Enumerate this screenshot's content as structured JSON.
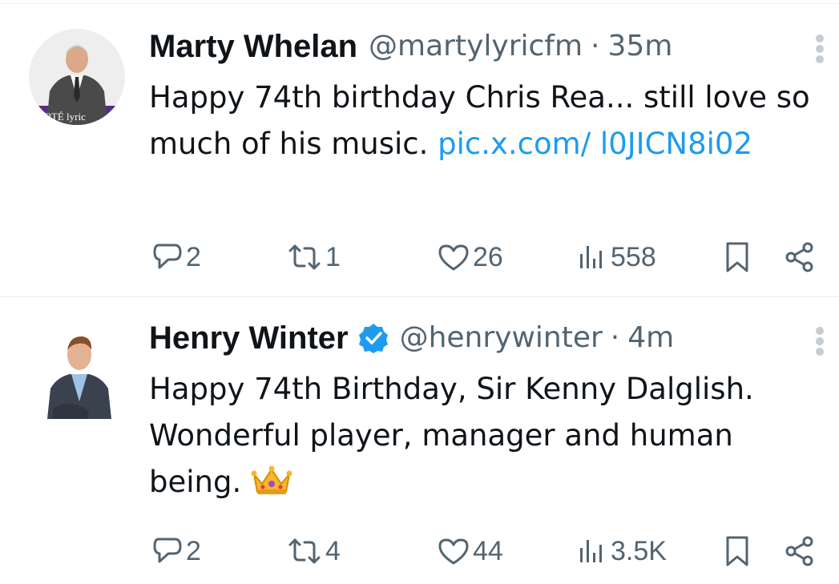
{
  "tweets": [
    {
      "name": "Marty Whelan",
      "handle": "@martylyricfm",
      "separator": "·",
      "time": "35m",
      "verified": false,
      "avatar_text": "RTÉ lyric",
      "text": "Happy 74th birthday Chris Rea... still love so much of his music. ",
      "link_text": "pic.x.com/ l0JICN8i02",
      "emoji": "",
      "stats": {
        "replies": "2",
        "reposts": "1",
        "likes": "26",
        "views": "558"
      }
    },
    {
      "name": "Henry Winter",
      "handle": "@henrywinter",
      "separator": "·",
      "time": "4m",
      "verified": true,
      "text": "Happy 74th Birthday, Sir Kenny Dalglish. Wonderful player, manager and human being. ",
      "link_text": "",
      "emoji": "crown-emoji",
      "stats": {
        "replies": "2",
        "reposts": "4",
        "likes": "44",
        "views": "3.5K"
      }
    }
  ],
  "colors": {
    "text": "#0f1419",
    "secondary": "#536471",
    "link": "#1d9bf0",
    "verified": "#1d9bf0",
    "divider": "#e6ecf0"
  },
  "icons": [
    "reply-icon",
    "repost-icon",
    "like-icon",
    "views-icon",
    "bookmark-icon",
    "share-icon",
    "more-options-icon",
    "verified-badge-icon"
  ]
}
